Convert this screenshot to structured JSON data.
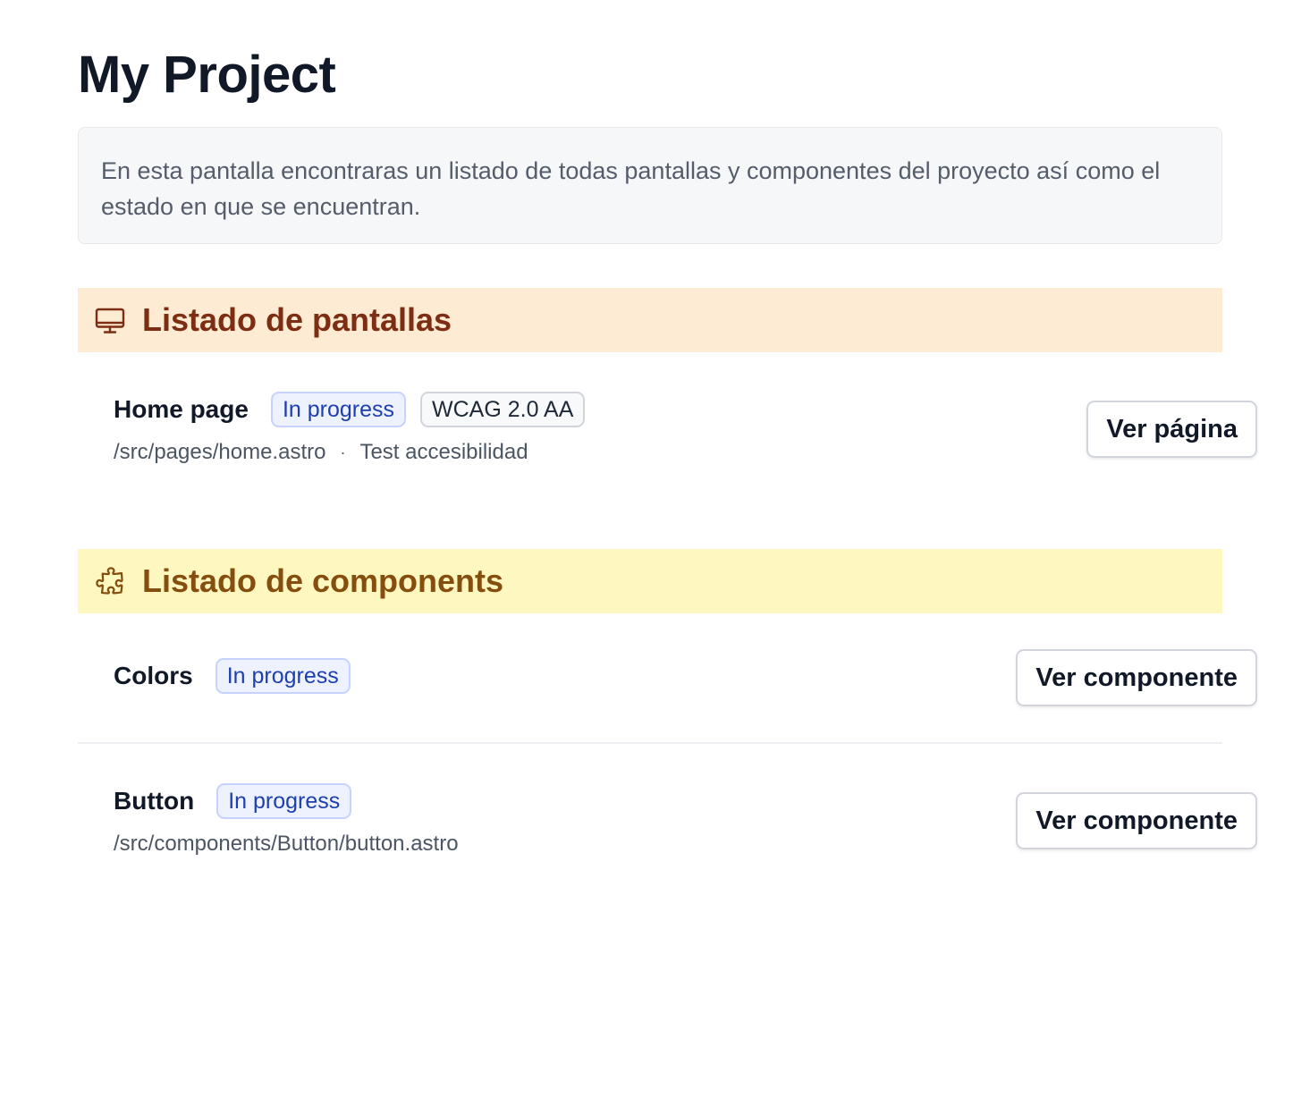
{
  "page": {
    "title": "My Project",
    "description": "En esta pantalla encontraras un listado de todas pantallas y componentes del proyecto así como el estado en que se encuentran."
  },
  "screens_section": {
    "title": "Listado de pantallas",
    "icon": "monitor-icon",
    "color": "#7c2d12",
    "background": "#fdebd3",
    "items": [
      {
        "name": "Home page",
        "status": "In progress",
        "tag": "WCAG 2.0 AA",
        "path": "/src/pages/home.astro",
        "separator": "·",
        "test_label": "Test accesibilidad",
        "button_label": "Ver página"
      }
    ]
  },
  "components_section": {
    "title": "Listado de components",
    "icon": "puzzle-icon",
    "color": "#854d0e",
    "background": "#fef8c0",
    "items": [
      {
        "name": "Colors",
        "status": "In progress",
        "button_label": "Ver componente"
      },
      {
        "name": "Button",
        "status": "In progress",
        "path": "/src/components/Button/button.astro",
        "button_label": "Ver componente"
      }
    ]
  }
}
